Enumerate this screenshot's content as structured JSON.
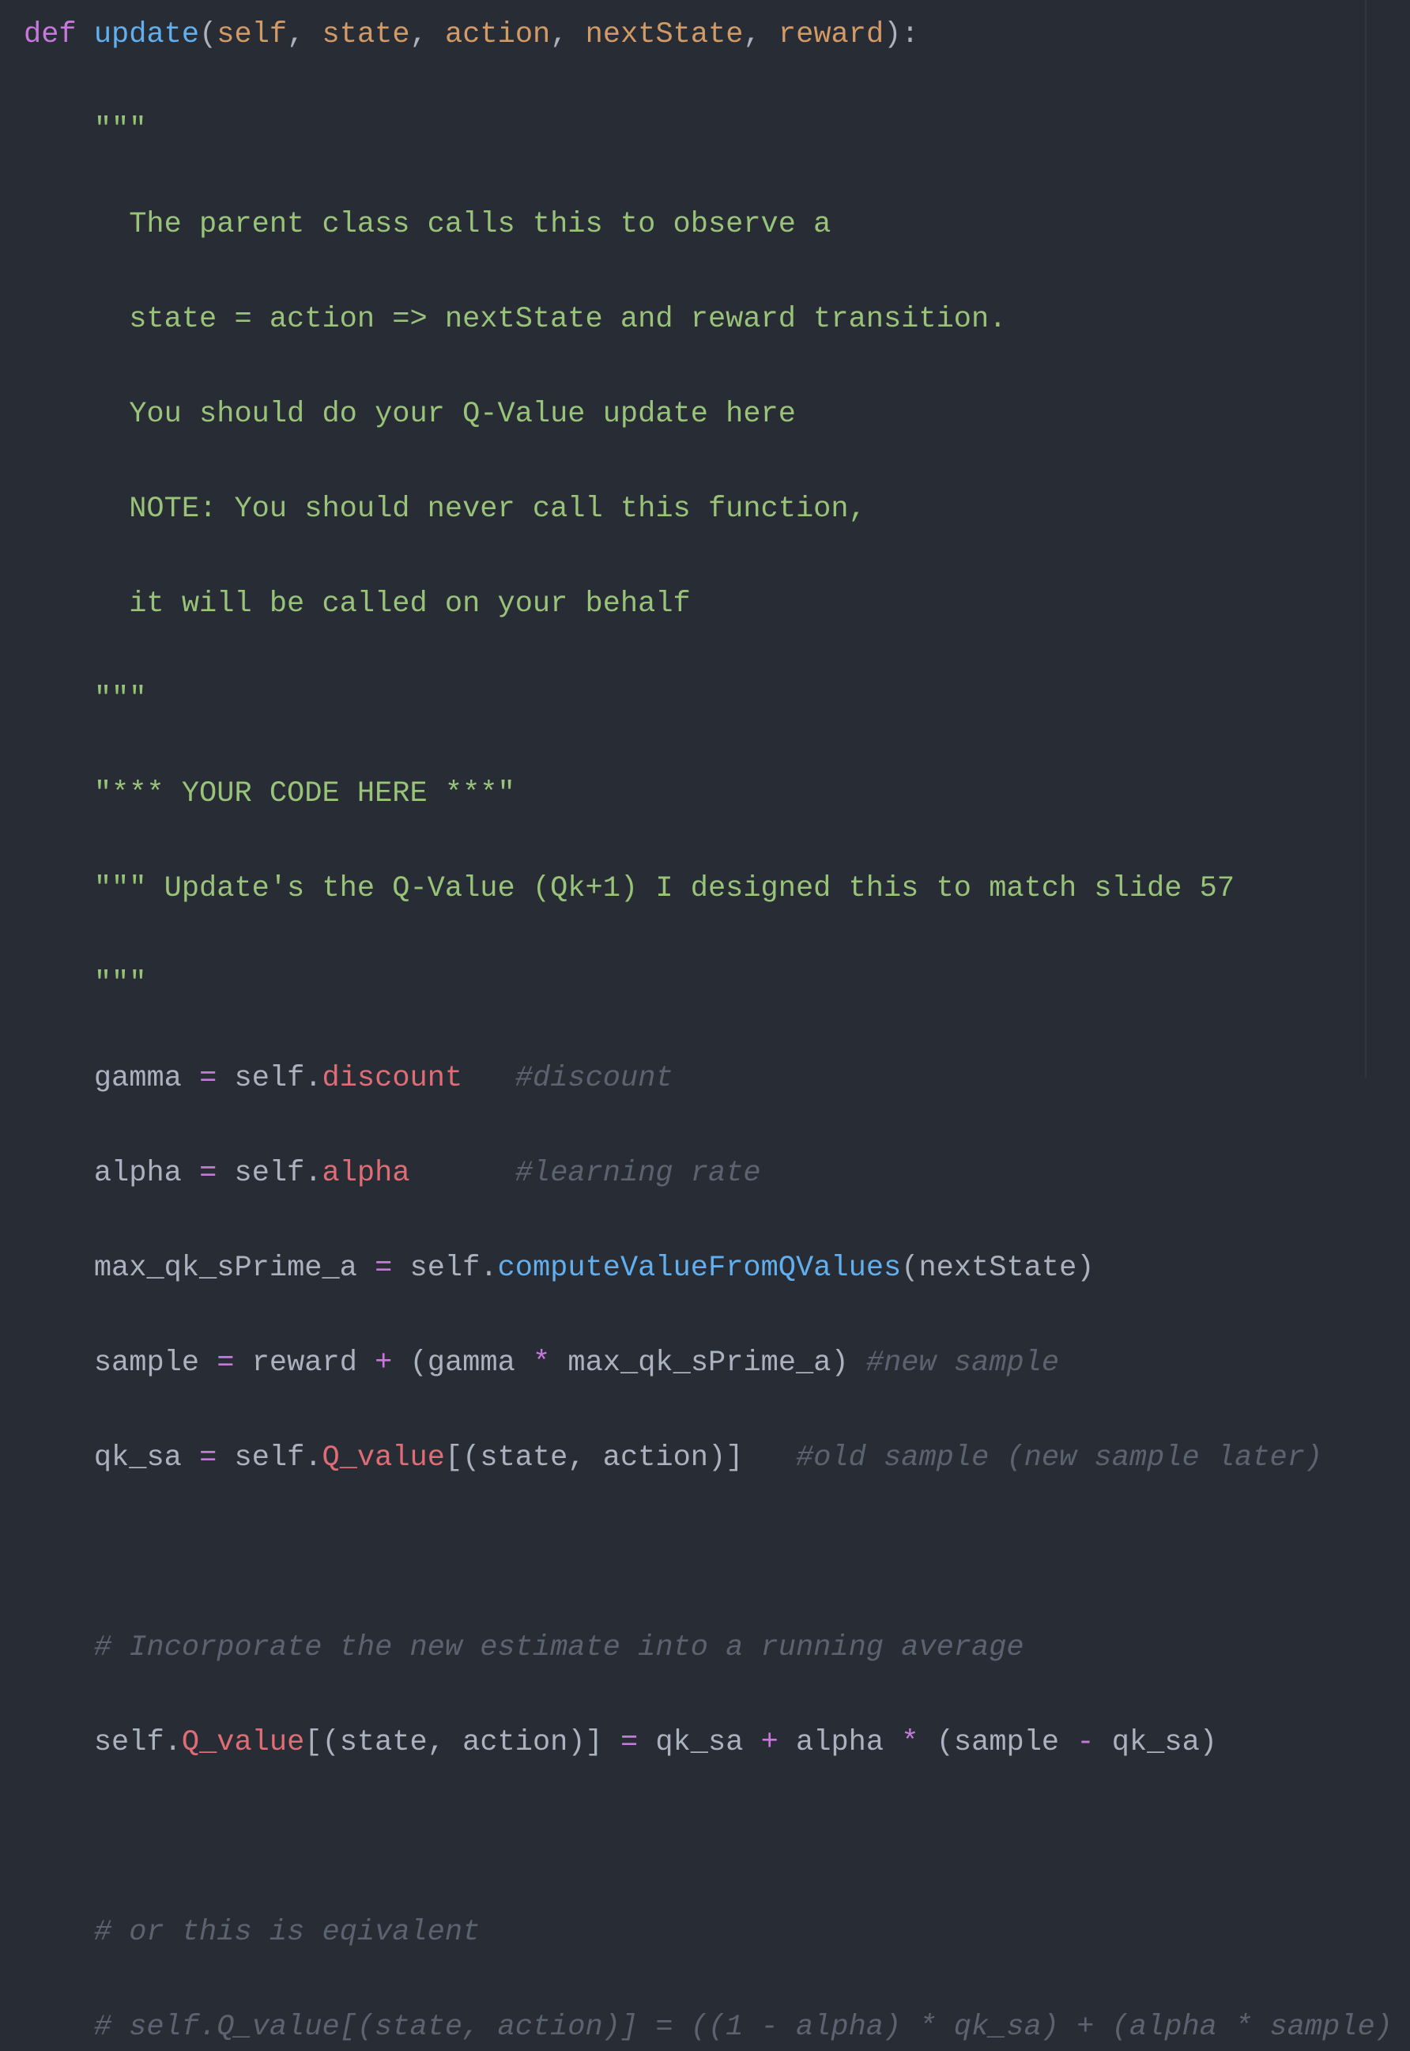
{
  "theme": {
    "background": "#282c34",
    "keyword": "#c678dd",
    "function": "#61afef",
    "parameter": "#d19a66",
    "string": "#98c379",
    "attribute": "#e06c75",
    "comment": "#5c6370",
    "text": "#abb2bf"
  },
  "code": {
    "l1": {
      "def": "def",
      "name": "update",
      "open": "(",
      "p1": "self",
      "c1": ", ",
      "p2": "state",
      "c2": ", ",
      "p3": "action",
      "c3": ", ",
      "p4": "nextState",
      "c4": ", ",
      "p5": "reward",
      "close": "):"
    },
    "doc_open": "    \"\"\"",
    "doc_lines": [
      "      The parent class calls this to observe a",
      "      state = action => nextState and reward transition.",
      "      You should do your Q-Value update here",
      "      NOTE: You should never call this function,",
      "      it will be called on your behalf"
    ],
    "doc_close": "    \"\"\"",
    "your_code": "    \"*** YOUR CODE HERE ***\"",
    "update_doc": "    \"\"\" Update's the Q-Value (Qk+1) I designed this to match slide 57",
    "update_doc_close": "    \"\"\"",
    "gamma": {
      "indent": "    ",
      "var": "gamma",
      "eq": " = ",
      "obj": "self.",
      "attr": "discount",
      "pad": "   ",
      "comment": "#discount"
    },
    "alpha": {
      "indent": "    ",
      "var": "alpha",
      "eq": " = ",
      "obj": "self.",
      "attr": "alpha",
      "pad": "      ",
      "comment": "#learning rate"
    },
    "maxq": {
      "indent": "    ",
      "var": "max_qk_sPrime_a",
      "eq": " = ",
      "obj": "self.",
      "method": "computeValueFromQValues",
      "args": "(nextState)"
    },
    "sample": {
      "indent": "    ",
      "var": "sample",
      "eq": " = ",
      "t1": "reward",
      "plus": " + ",
      "t2": "(gamma",
      "mul": " * ",
      "t3": "max_qk_sPrime_a)",
      "pad": " ",
      "comment": "#new sample"
    },
    "qk": {
      "indent": "    ",
      "var": "qk_sa",
      "eq": " = ",
      "obj": "self.",
      "attr": "Q_value",
      "args": "[(state, action)]",
      "pad": "   ",
      "comment": "#old sample (new sample later)"
    },
    "comment_running": "    # Incorporate the new estimate into a running average",
    "assign": {
      "indent": "    ",
      "obj": "self.",
      "attr": "Q_value",
      "args": "[(state, action)]",
      "eq": " = ",
      "t1": "qk_sa",
      "plus": " + ",
      "t2": "alpha",
      "mul": " * ",
      "t3": "(sample",
      "minus": " - ",
      "t4": "qk_sa)"
    },
    "comment_equiv": "    # or this is eqivalent",
    "comment_alt": "    # self.Q_value[(state, action)] = ((1 - alpha) * qk_sa) + (alpha * sample)"
  }
}
